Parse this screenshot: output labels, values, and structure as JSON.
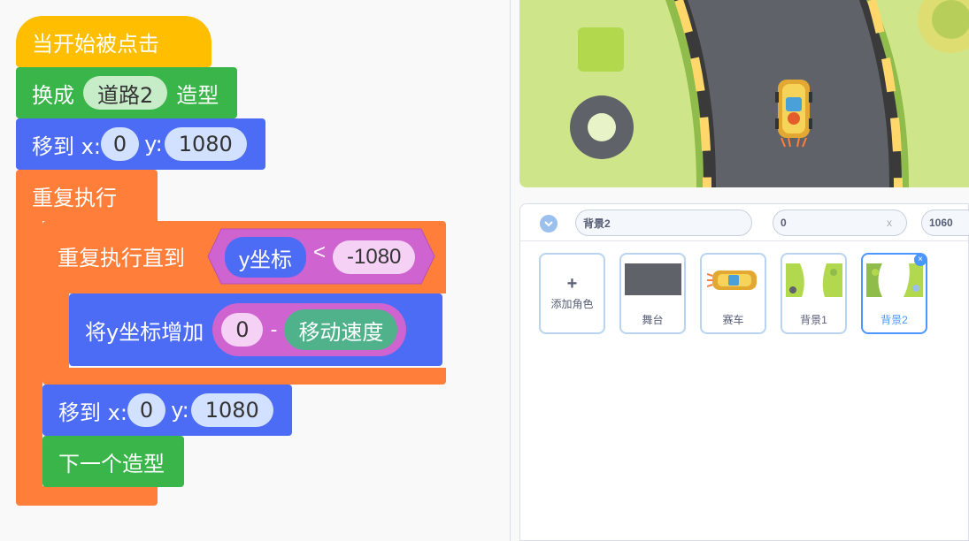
{
  "script": {
    "hat_label": "当开始被点击",
    "switch_costume": {
      "label": "换成",
      "costume": "道路2",
      "suffix": "造型"
    },
    "goto_1": {
      "label": "移到 x:",
      "x": "0",
      "ylabel": "y:",
      "y": "1080"
    },
    "forever_label": "重复执行",
    "repeat_until": {
      "label": "重复执行直到",
      "reporter": "y坐标",
      "op": "<",
      "value": "-1080"
    },
    "change_y": {
      "label": "将y坐标增加",
      "left": "0",
      "op": "-",
      "variable": "移动速度"
    },
    "goto_2": {
      "label": "移到 x:",
      "x": "0",
      "ylabel": "y:",
      "y": "1080"
    },
    "next_costume_label": "下一个造型"
  },
  "sprite_info": {
    "name": "背景2",
    "x": "0",
    "x_clear": "x",
    "y": "1060"
  },
  "sprites": {
    "add_label": "添加角色",
    "add_icon": "+",
    "items": [
      {
        "label": "舞台"
      },
      {
        "label": "赛车"
      },
      {
        "label": "背景1"
      },
      {
        "label": "背景2"
      }
    ]
  },
  "colors": {
    "events": "#ffbf00",
    "looks": "#39b54a",
    "motion": "#4c6cf5",
    "control": "#ff7f3a",
    "operators": "#cf63cf",
    "variables": "#4fb28a",
    "selected": "#4c97ff"
  }
}
